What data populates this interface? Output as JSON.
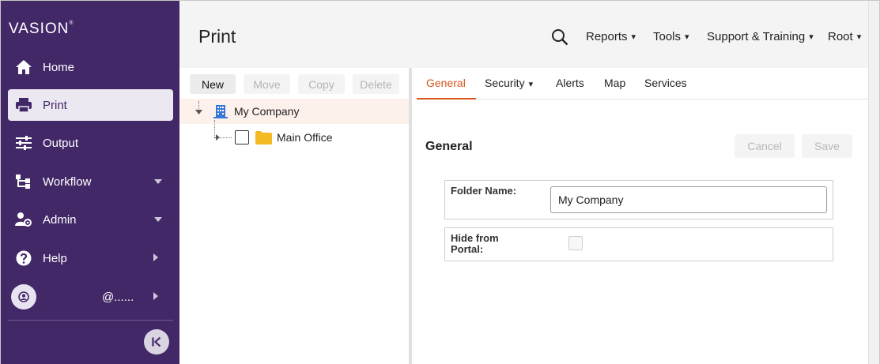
{
  "sidebar": {
    "logo": "VASION",
    "logo_mark": "®",
    "items": [
      {
        "label": "Home",
        "icon": "home-icon"
      },
      {
        "label": "Print",
        "icon": "printer-icon",
        "active": true
      },
      {
        "label": "Output",
        "icon": "sliders-icon"
      },
      {
        "label": "Workflow",
        "icon": "workflow-icon",
        "expandable": true
      },
      {
        "label": "Admin",
        "icon": "admin-user-icon",
        "expandable": true
      },
      {
        "label": "Help",
        "icon": "help-icon",
        "submenu": true
      }
    ],
    "user": {
      "name": "@......",
      "icon": "user-avatar-icon"
    },
    "collapse_icon": "collapse-sidebar-icon"
  },
  "header": {
    "title": "Print",
    "search_icon": "search-icon",
    "menus": [
      {
        "label": "Reports",
        "caret": "▾"
      },
      {
        "label": "Tools",
        "caret": "▾"
      },
      {
        "label": "Support & Training",
        "caret": "▾"
      },
      {
        "label": "Root",
        "caret": "▾"
      }
    ]
  },
  "tree": {
    "toolbar": {
      "new": "New",
      "move": "Move",
      "copy": "Copy",
      "delete": "Delete"
    },
    "nodes": [
      {
        "label": "My Company",
        "icon": "building-icon",
        "expanded": true,
        "selected": true
      },
      {
        "label": "Main Office",
        "icon": "folder-icon",
        "checked": false
      }
    ]
  },
  "detail": {
    "tabs": [
      {
        "label": "General",
        "active": true
      },
      {
        "label": "Security",
        "caret": "▾"
      },
      {
        "label": "Alerts"
      },
      {
        "label": "Map"
      },
      {
        "label": "Services"
      }
    ],
    "section_title": "General",
    "cancel_label": "Cancel",
    "save_label": "Save",
    "folder_name_label": "Folder Name:",
    "folder_name_value": "My Company",
    "hide_from_portal_line1": "Hide from",
    "hide_from_portal_line2": "Portal:",
    "hide_from_portal_checked": false
  },
  "colors": {
    "sidebar_bg": "#432868",
    "accent": "#d9541c",
    "selected_row": "#fdf1ec",
    "folder": "#f5b921",
    "building": "#3a78d8"
  }
}
